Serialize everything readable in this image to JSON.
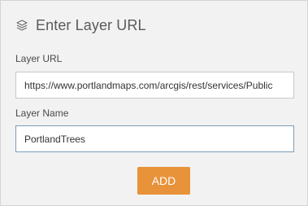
{
  "header": {
    "icon": "layers-icon",
    "title": "Enter Layer URL"
  },
  "form": {
    "url_label": "Layer URL",
    "url_value": "https://www.portlandmaps.com/arcgis/rest/services/Public",
    "name_label": "Layer Name",
    "name_value": "PortlandTrees"
  },
  "actions": {
    "add_label": "ADD"
  },
  "colors": {
    "accent": "#e8923a",
    "panel_bg": "#f2f2f2"
  }
}
